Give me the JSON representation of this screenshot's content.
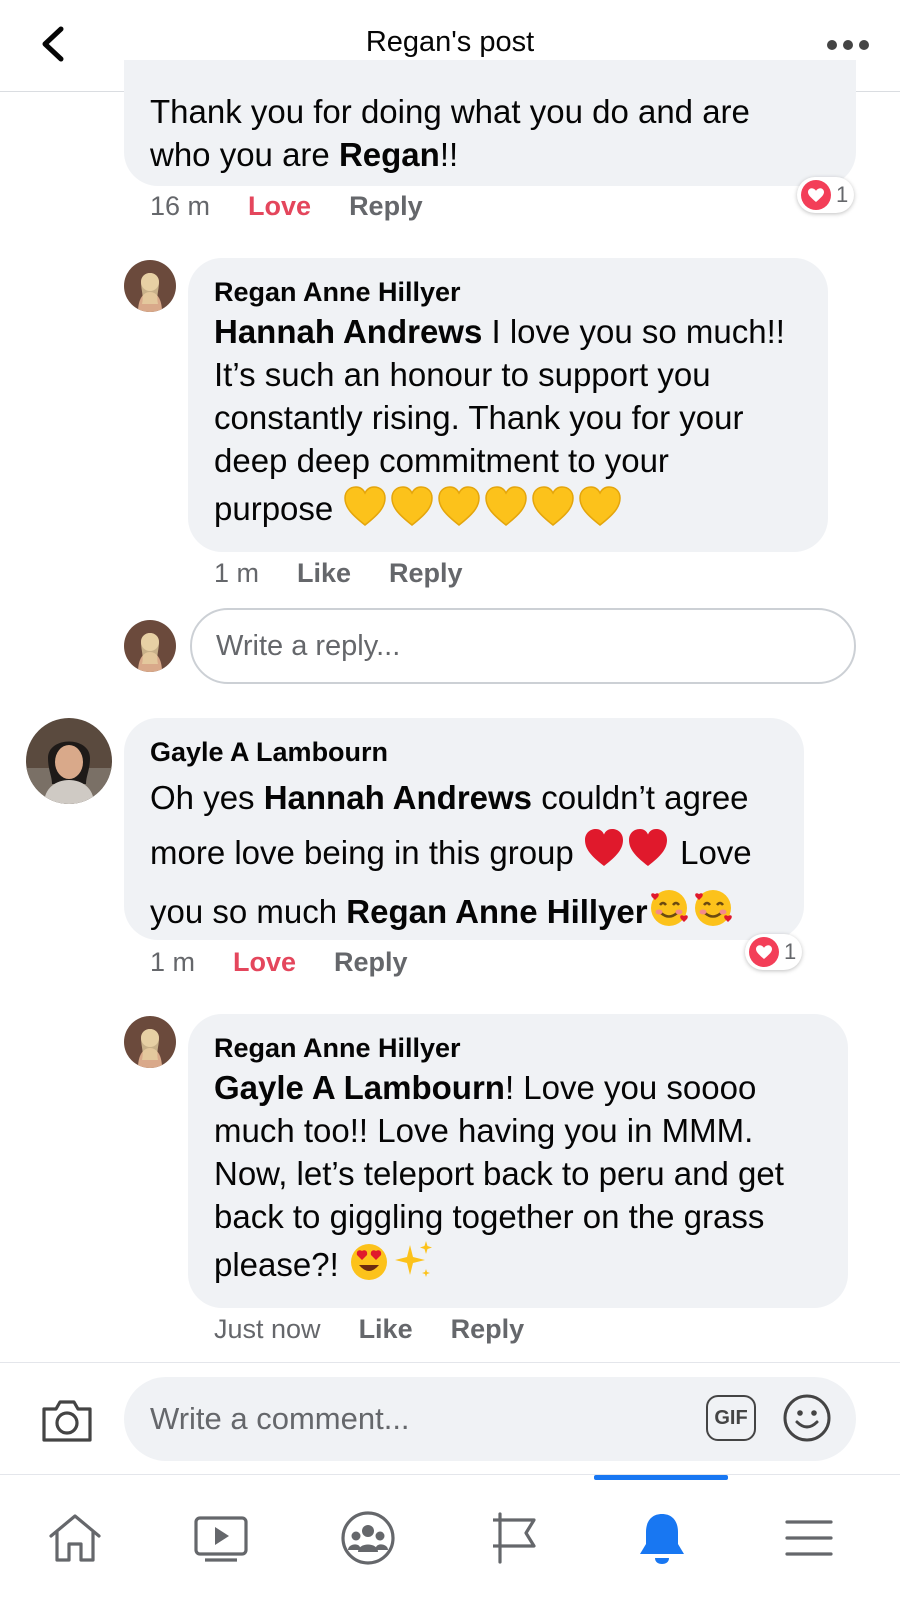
{
  "header": {
    "title": "Regan's post"
  },
  "comments": [
    {
      "text_1": "Thank you for doing what you do and are",
      "text_2_pre": "who you are ",
      "text_2_bold": "Regan",
      "text_2_post": "!!",
      "time": "16 m",
      "action_1": "Love",
      "action_2": "Reply",
      "reaction_count": "1"
    },
    {
      "author": "Regan Anne Hillyer",
      "mention": "Hannah Andrews",
      "line_1": " I love you so much!!",
      "line_2": "It’s such an honour to support you",
      "line_3": "constantly rising. Thank you for your",
      "line_4": "deep deep commitment to your",
      "line_5": "purpose ",
      "time": "1 m",
      "action_1": "Like",
      "action_2": "Reply"
    },
    {
      "author": "Gayle A Lambourn",
      "line_1_pre": "Oh yes ",
      "mention": "Hannah Andrews",
      "line_1_post": " couldn’t agree",
      "line_2_pre": "more love being in this group ",
      "line_2_post": " Love",
      "line_3_pre": "you so much ",
      "mention_2": "Regan Anne Hillyer",
      "time": "1 m",
      "action_1": "Love",
      "action_2": "Reply",
      "reaction_count": "1"
    },
    {
      "author": "Regan Anne Hillyer",
      "mention": "Gayle A Lambourn",
      "line_1": "! Love you soooo",
      "line_2": "much too!! Love having you in MMM.",
      "line_3": "Now, let’s teleport back to peru and get",
      "line_4": "back to giggling together on the grass",
      "line_5": "please?! ",
      "time": "Just now",
      "action_1": "Like",
      "action_2": "Reply"
    }
  ],
  "reply_input": {
    "placeholder": "Write a reply..."
  },
  "comment_bar": {
    "placeholder": "Write a comment...",
    "gif_label": "GIF"
  },
  "tabs": [
    "home-icon",
    "video-icon",
    "groups-icon",
    "pages-flag-icon",
    "notifications-bell-icon",
    "menu-icon"
  ],
  "colors": {
    "love": "#e4465c",
    "accent": "#1877f2",
    "bubble": "#f0f2f5",
    "meta": "#65676b"
  }
}
